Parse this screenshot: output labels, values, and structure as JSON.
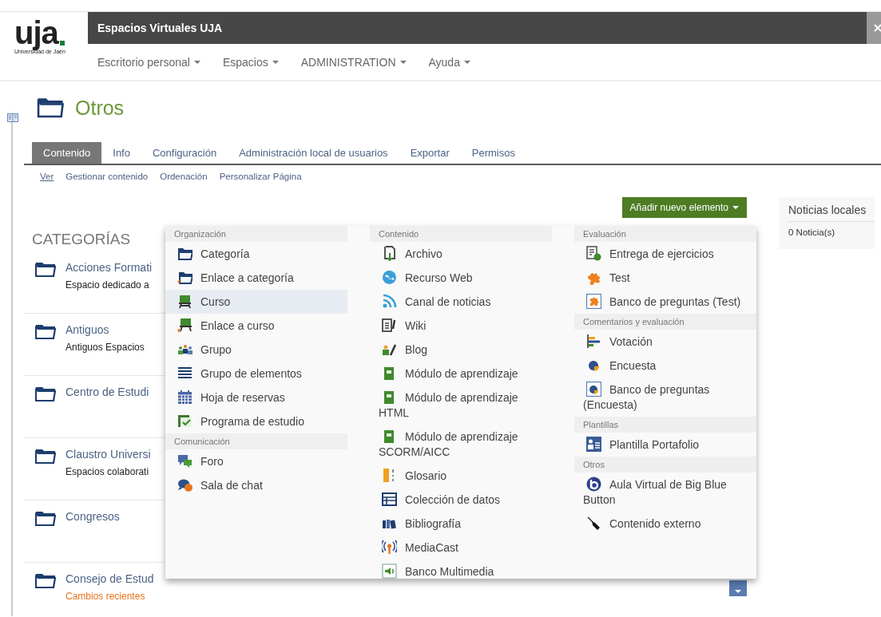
{
  "header": {
    "logo": "uja",
    "logo_subtitle": "Universidad de Jaén",
    "site_title": "Espacios Virtuales UJA",
    "nav": [
      {
        "label": "Escritorio personal"
      },
      {
        "label": "Espacios"
      },
      {
        "label": "ADMINISTRATION"
      },
      {
        "label": "Ayuda"
      }
    ]
  },
  "page": {
    "title": "Otros",
    "tabs": [
      {
        "label": "Contenido",
        "selected": true
      },
      {
        "label": "Info",
        "selected": false
      },
      {
        "label": "Configuración",
        "selected": false
      },
      {
        "label": "Administración local de usuarios",
        "selected": false
      },
      {
        "label": "Exportar",
        "selected": false
      },
      {
        "label": "Permisos",
        "selected": false
      }
    ],
    "subnav": [
      {
        "label": "Ver",
        "selected": true
      },
      {
        "label": "Gestionar contenido",
        "selected": false
      },
      {
        "label": "Ordenación",
        "selected": false
      },
      {
        "label": "Personalizar Página",
        "selected": false
      }
    ],
    "add_button": "Añadir nuevo elemento",
    "categories_heading": "CATEGORÍAS",
    "categories": [
      {
        "name": "Acciones Formati",
        "description": "Espacio dedicado a"
      },
      {
        "name": "Antiguos",
        "description": "Antiguos Espacios"
      },
      {
        "name": "Centro de Estudi"
      },
      {
        "name": "Claustro Universi",
        "description": "Espacios colaborati"
      },
      {
        "name": "Congresos"
      },
      {
        "name": "Consejo de Estud",
        "link": "Cambios recientes",
        "menu_button": true
      }
    ]
  },
  "news": {
    "title": "Noticias locales",
    "count": "0 Noticia(s)"
  },
  "add_menu": {
    "columns": [
      {
        "sections": [
          {
            "heading": "Organización",
            "items": [
              {
                "label": "Categoría",
                "selected": false
              },
              {
                "label": "Enlace a categoría",
                "selected": false
              },
              {
                "label": "Curso",
                "selected": true
              },
              {
                "label": "Enlace a curso",
                "selected": false
              },
              {
                "label": "Grupo",
                "selected": false
              },
              {
                "label": "Grupo de elementos",
                "selected": false
              },
              {
                "label": "Hoja de reservas",
                "selected": false
              },
              {
                "label": "Programa de estudio",
                "selected": false
              }
            ]
          },
          {
            "heading": "Comunicación",
            "items": [
              {
                "label": "Foro",
                "selected": false
              },
              {
                "label": "Sala de chat",
                "selected": false
              }
            ]
          }
        ]
      },
      {
        "sections": [
          {
            "heading": "Contenido",
            "items": [
              {
                "label": "Archivo",
                "selected": false
              },
              {
                "label": "Recurso Web",
                "selected": false
              },
              {
                "label": "Canal de noticias",
                "selected": false
              },
              {
                "label": "Wiki",
                "selected": false
              },
              {
                "label": "Blog",
                "selected": false
              },
              {
                "label": "Módulo de aprendizaje",
                "selected": false
              },
              {
                "label": "Módulo de aprendizaje HTML",
                "selected": false
              },
              {
                "label": "Módulo de aprendizaje SCORM/AICC",
                "selected": false
              },
              {
                "label": "Glosario",
                "selected": false
              },
              {
                "label": "Colección de datos",
                "selected": false
              },
              {
                "label": "Bibliografía",
                "selected": false
              },
              {
                "label": "MediaCast",
                "selected": false
              },
              {
                "label": "Banco Multimedia",
                "selected": false
              }
            ]
          }
        ]
      },
      {
        "sections": [
          {
            "heading": "Evaluación",
            "items": [
              {
                "label": "Entrega de ejercicios",
                "selected": false
              },
              {
                "label": "Test",
                "selected": false
              },
              {
                "label": "Banco de preguntas (Test)",
                "selected": false
              }
            ]
          },
          {
            "heading": "Comentarios y evaluación",
            "items": [
              {
                "label": "Votación",
                "selected": false
              },
              {
                "label": "Encuesta",
                "selected": false
              },
              {
                "label": "Banco de preguntas (Encuesta)",
                "selected": false
              }
            ]
          },
          {
            "heading": "Plantillas",
            "items": [
              {
                "label": "Plantilla Portafolio",
                "selected": false
              }
            ]
          },
          {
            "heading": "Otros",
            "items": [
              {
                "label": "Aula Virtual de Big Blue Button",
                "selected": false
              },
              {
                "label": "Contenido externo",
                "selected": false
              }
            ]
          }
        ]
      }
    ]
  }
}
